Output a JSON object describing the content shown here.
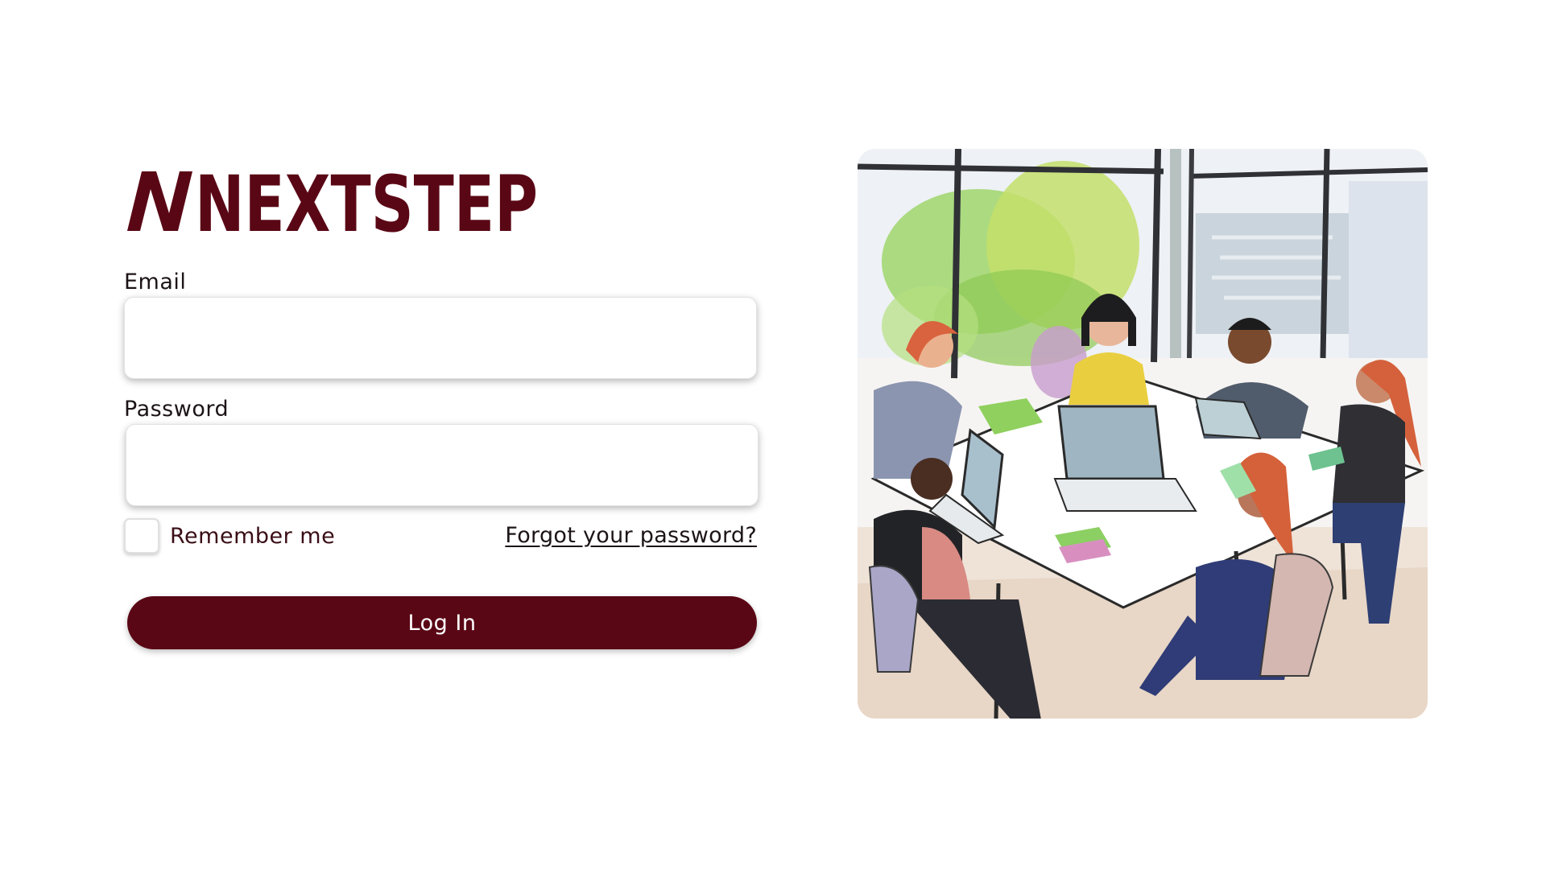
{
  "brand": {
    "logo_text": "NEXTSTEP",
    "color": "#5a0715"
  },
  "form": {
    "email_label": "Email",
    "email_value": "",
    "password_label": "Password",
    "password_value": "",
    "remember_label": "Remember me",
    "remember_checked": false,
    "forgot_link": "Forgot your password?",
    "submit_label": "Log In"
  },
  "illustration": {
    "subject": "watercolor illustration of a team meeting around a table with laptops"
  }
}
